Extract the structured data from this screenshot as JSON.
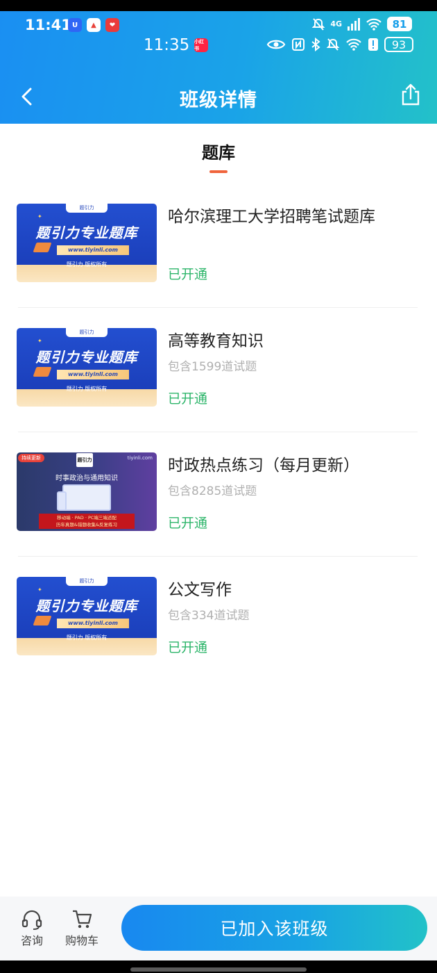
{
  "status_outer": {
    "time": "11:41",
    "network": "4G",
    "battery": "81",
    "app_icons": [
      {
        "name": "app-icon-blue",
        "color": "#2f66f5",
        "glyph": "U"
      },
      {
        "name": "app-icon-red",
        "color": "#e8423a",
        "glyph": "▲"
      },
      {
        "name": "app-icon-red2",
        "color": "#ea3b3b",
        "glyph": "❤"
      }
    ]
  },
  "status_inner": {
    "time": "11:35",
    "badge": "小红书",
    "battery": "93"
  },
  "header": {
    "title": "班级详情"
  },
  "tab": {
    "label": "题库"
  },
  "thumb_text": {
    "brand": "题引力专业题库",
    "url": "www.tiyinli.com",
    "copyright": "题引力 版权所有",
    "logo": "题引力",
    "alt_chip": "持续更新",
    "alt_site": "tiyinli.com",
    "alt_headline": "时事政治与通用知识",
    "alt_banner_1": "移动端 · PAD · PC端三端适配",
    "alt_banner_2": "历年真题&错题收集&反复练习"
  },
  "items": [
    {
      "name": "哈尔滨理工大学招聘笔试题库",
      "count": "",
      "status": "已开通"
    },
    {
      "name": "高等教育知识",
      "count": "包含1599道试题",
      "status": "已开通"
    },
    {
      "name": "时政热点练习（每月更新）",
      "count": "包含8285道试题",
      "status": "已开通"
    },
    {
      "name": "公文写作",
      "count": "包含334道试题",
      "status": "已开通"
    }
  ],
  "bottom": {
    "consult": "咨询",
    "cart": "购物车",
    "join": "已加入该班级"
  },
  "colors": {
    "accent": "#1a8ff2",
    "accent_end": "#23c1c9",
    "status_green": "#2db56a",
    "tab_underline": "#f0643c"
  }
}
